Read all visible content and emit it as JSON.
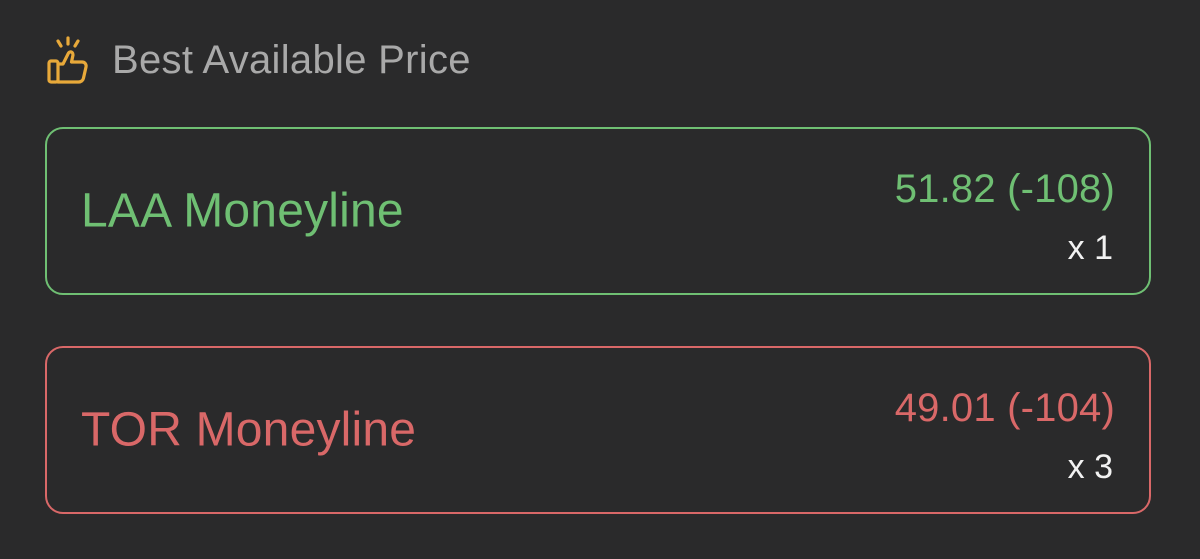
{
  "header": {
    "title": "Best Available Price",
    "icon": "thumbs-up-icon",
    "icon_color": "#e8a93a"
  },
  "offers": [
    {
      "market": "LAA Moneyline",
      "price": "51.82 (-108)",
      "quantity": "x 1",
      "color": "#6fbf73"
    },
    {
      "market": "TOR Moneyline",
      "price": "49.01 (-104)",
      "quantity": "x 3",
      "color": "#d96868"
    }
  ]
}
